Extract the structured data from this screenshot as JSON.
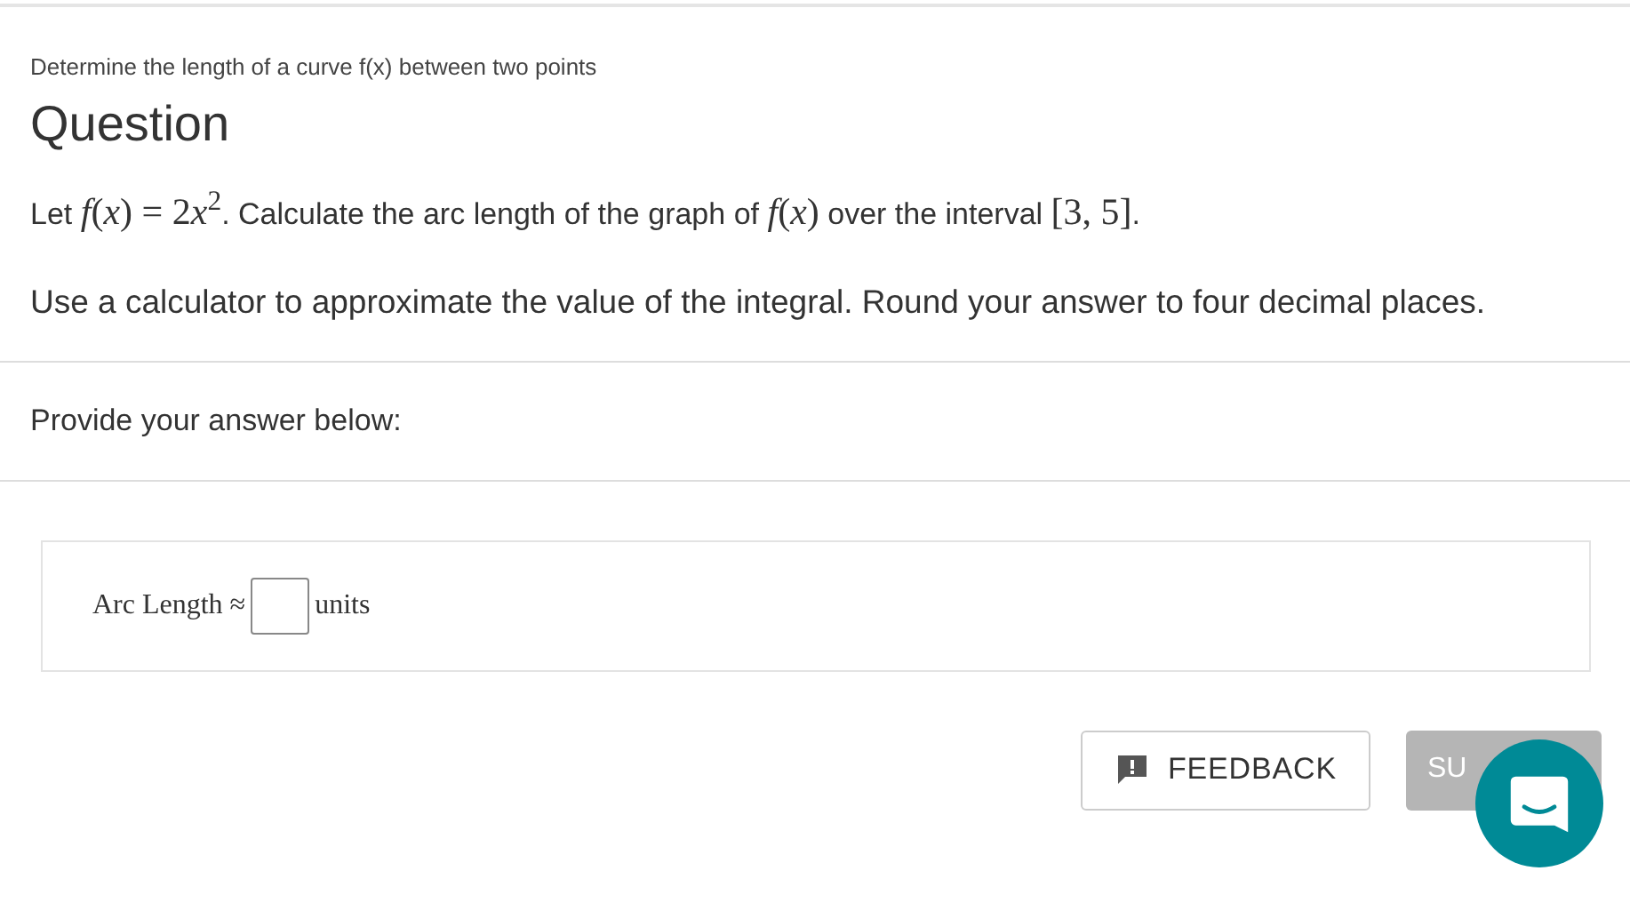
{
  "subtitle": "Determine the length of a curve f(x) between two points",
  "heading": "Question",
  "question": [
    {
      "kind": "text",
      "s": "Let "
    },
    {
      "kind": "math",
      "s": "*f*(*x*) = 2"
    },
    {
      "kind": "math",
      "s": "*x*$^{2}$"
    },
    {
      "kind": "text",
      "s": ". Calculate the arc length of the graph of "
    },
    {
      "kind": "math",
      "s": "*f*(*x*)"
    },
    {
      "kind": "text",
      "s": " over the interval "
    },
    {
      "kind": "math",
      "s": "[3, 5]"
    },
    {
      "kind": "text",
      "s": "."
    }
  ],
  "instruction": "Use a calculator to approximate the value of the integral. Round your answer to four decimal places.",
  "answer_prompt": "Provide your answer below:",
  "answer": {
    "label": "Arc Length ≈",
    "unit": "units"
  },
  "buttons": [
    {
      "kind": "feedback",
      "label": "FEEDBACK"
    },
    {
      "kind": "submit",
      "label": "SU",
      "disabled": true
    }
  ]
}
